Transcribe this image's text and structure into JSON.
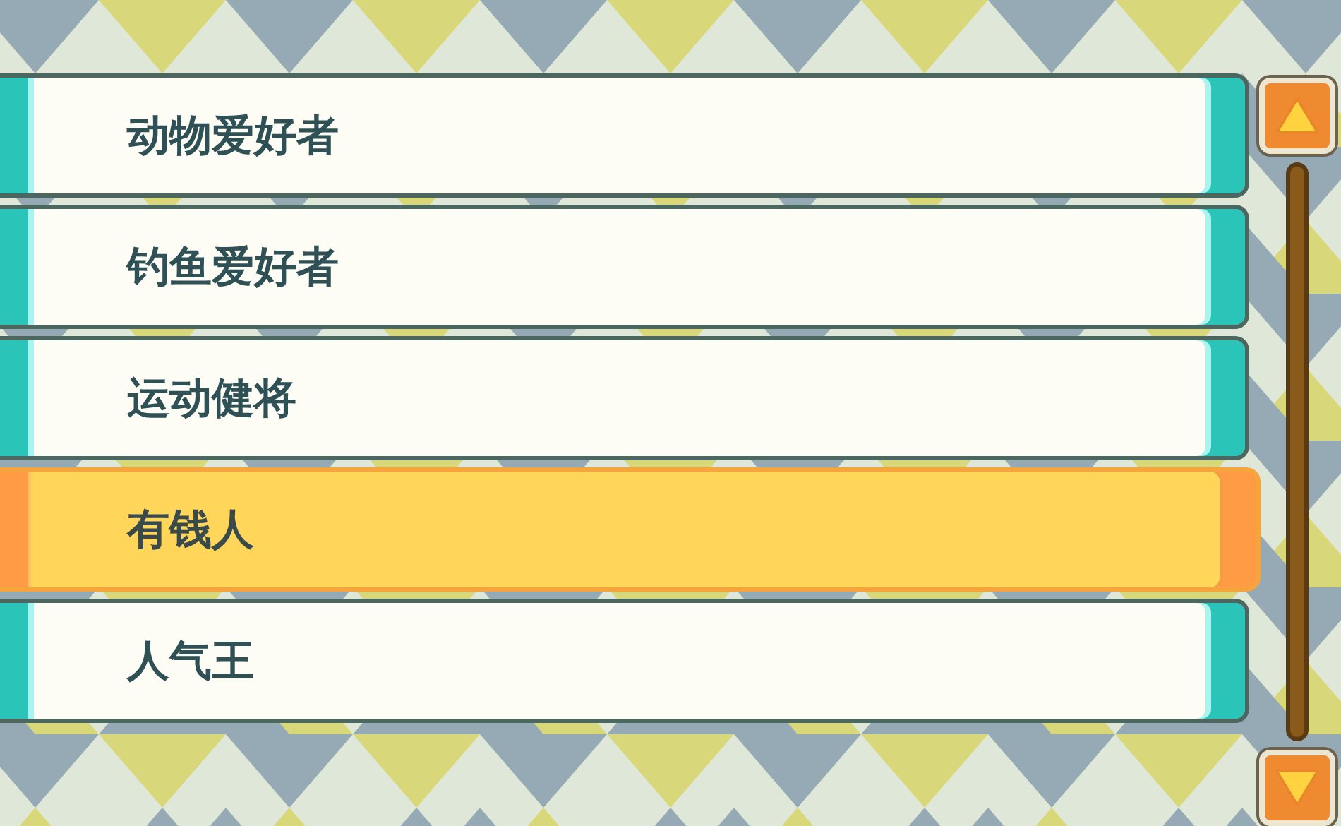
{
  "list": {
    "items": [
      {
        "label": "动物爱好者",
        "selected": false
      },
      {
        "label": "钓鱼爱好者",
        "selected": false
      },
      {
        "label": "运动健将",
        "selected": false
      },
      {
        "label": "有钱人",
        "selected": true
      },
      {
        "label": "人气王",
        "selected": false
      }
    ]
  }
}
